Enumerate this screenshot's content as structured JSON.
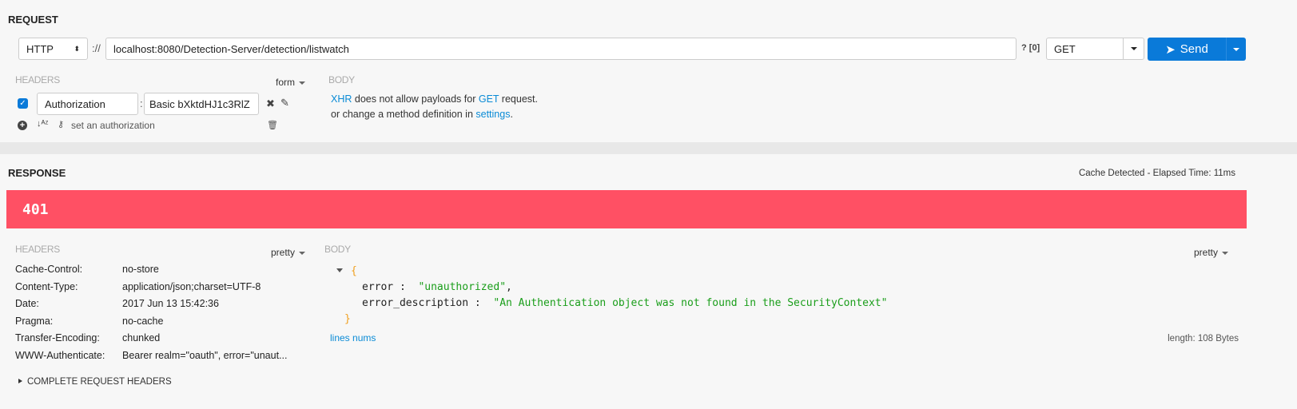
{
  "request": {
    "title": "REQUEST",
    "scheme": "HTTP",
    "separator": "://",
    "url": "localhost:8080/Detection-Server/detection/listwatch",
    "query_info": "? [0]",
    "method": "GET",
    "send_label": "Send",
    "headers_label": "HEADERS",
    "headers_mode": "form",
    "body_label": "BODY",
    "header_row": {
      "enabled": true,
      "key": "Authorization",
      "value": "Basic bXktdHJ1c3RlZ"
    },
    "set_auth_label": "set an authorization",
    "body_msg": {
      "xhr": "XHR",
      "part1": " does not allow payloads for ",
      "get": "GET",
      "part2": " request.",
      "line2": "or change a method definition in ",
      "settings": "settings",
      "end": "."
    }
  },
  "response": {
    "title": "RESPONSE",
    "timing": "Cache Detected - Elapsed Time: 11ms",
    "status": "401",
    "status_color": "#ff5064",
    "headers_label": "HEADERS",
    "headers_mode": "pretty",
    "body_label": "BODY",
    "body_mode": "pretty",
    "headers": [
      {
        "k": "Cache-Control:",
        "v": "no-store"
      },
      {
        "k": "Content-Type:",
        "v": "application/json;charset=UTF-8"
      },
      {
        "k": "Date:",
        "v": "2017 Jun 13 15:42:36"
      },
      {
        "k": "Pragma:",
        "v": "no-cache"
      },
      {
        "k": "Transfer-Encoding:",
        "v": "chunked"
      },
      {
        "k": "WWW-Authenticate:",
        "v": "Bearer realm=\"oauth\", error=\"unaut..."
      }
    ],
    "body": {
      "open": "{",
      "close": "}",
      "fields": [
        {
          "k": "error",
          "v": "\"unauthorized\"",
          "comma": ","
        },
        {
          "k": "error_description",
          "v": "\"An Authentication object was not found in the SecurityContext\"",
          "comma": ""
        }
      ]
    },
    "lines_nums": "lines nums",
    "length": "length: 108 Bytes",
    "complete_headers": "COMPLETE REQUEST HEADERS"
  }
}
